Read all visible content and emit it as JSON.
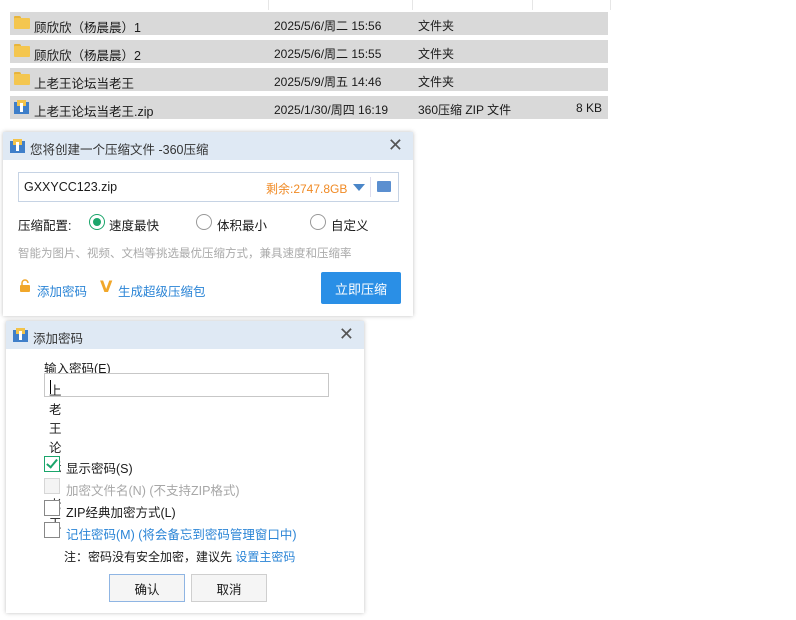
{
  "explorer": {
    "files": [
      {
        "name": "顾欣欣（杨晨晨）1",
        "date": "2025/5/6/周二 15:56",
        "type": "文件夹",
        "size": "",
        "icon": "folder-icon"
      },
      {
        "name": "顾欣欣（杨晨晨）2",
        "date": "2025/5/6/周二 15:55",
        "type": "文件夹",
        "size": "",
        "icon": "folder-icon"
      },
      {
        "name": "上老王论坛当老王",
        "date": "2025/5/9/周五 14:46",
        "type": "文件夹",
        "size": "",
        "icon": "folder-icon"
      },
      {
        "name": "上老王论坛当老王.zip",
        "date": "2025/1/30/周四 16:19",
        "type": "360压缩 ZIP 文件",
        "size": "8 KB",
        "icon": "zip-archive-icon"
      }
    ]
  },
  "compress_dialog": {
    "title": "您将创建一个压缩文件 -360压缩",
    "filename": "GXXYCC123.zip",
    "free_space": "剩余:2747.8GB",
    "config_label": "压缩配置:",
    "options": [
      "速度最快",
      "体积最小",
      "自定义"
    ],
    "selected_option": "速度最快",
    "hint": "智能为图片、视频、文档等挑选最优压缩方式，兼具速度和压缩率",
    "add_password": "添加密码",
    "super_pack": "生成超级压缩包",
    "compress_button": "立即压缩",
    "accent_color": "#2a8fe6"
  },
  "password_dialog": {
    "title": "添加密码",
    "input_label": "输入密码(E)",
    "password_value": "上老王论坛当老王",
    "show_password": "显示密码(S)",
    "encrypt_filenames": "加密文件名(N) (不支持ZIP格式)",
    "zip_classic": "ZIP经典加密方式(L)",
    "remember_password": "记住密码(M) (将会备忘到密码管理窗口中)",
    "note": "注：密码没有安全加密，建议先",
    "note_link": "设置主密码",
    "ok_button": "确认",
    "cancel_button": "取消"
  }
}
